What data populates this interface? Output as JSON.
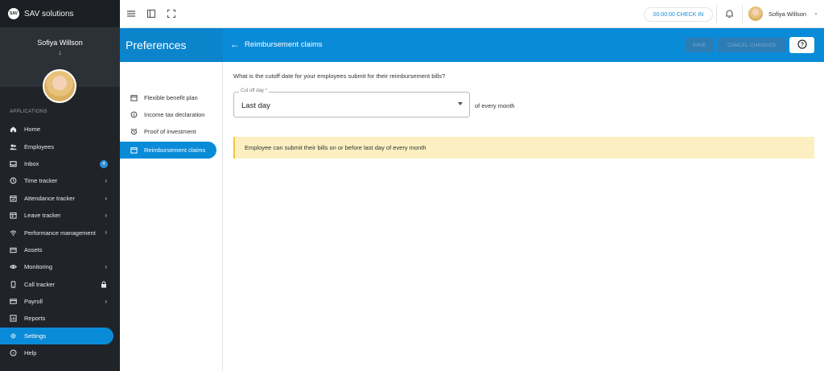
{
  "brand": {
    "logo_text": "SAV",
    "name": "SAV solutions"
  },
  "profile": {
    "name": "Sofiya Willson",
    "sub": "1"
  },
  "sidebar": {
    "section_label": "APPLICATIONS",
    "items": [
      {
        "label": "Home",
        "icon": "home-icon"
      },
      {
        "label": "Employees",
        "icon": "people-icon"
      },
      {
        "label": "Inbox",
        "icon": "inbox-icon",
        "badge": "4"
      },
      {
        "label": "Time tracker",
        "icon": "clock-icon",
        "has_chevron": true
      },
      {
        "label": "Attendance tracker",
        "icon": "calendar-check-icon",
        "has_chevron": true
      },
      {
        "label": "Leave tracker",
        "icon": "calendar-icon",
        "has_chevron": true
      },
      {
        "label": "Performance management",
        "icon": "signal-icon",
        "has_chevron": true
      },
      {
        "label": "Assets",
        "icon": "briefcase-icon"
      },
      {
        "label": "Monitoring",
        "icon": "eye-icon",
        "has_chevron": true
      },
      {
        "label": "Call tracker",
        "icon": "phone-icon",
        "locked": true
      },
      {
        "label": "Payroll",
        "icon": "card-icon",
        "has_chevron": true
      },
      {
        "label": "Reports",
        "icon": "report-icon"
      },
      {
        "label": "Settings",
        "icon": "gear-icon",
        "active": true
      },
      {
        "label": "Help",
        "icon": "help-icon"
      }
    ],
    "chevron": "›"
  },
  "topbar": {
    "checkin_label": "00:00:00 CHECK IN",
    "user_name": "Sofiya Willson",
    "user_menu_caret": "⌄"
  },
  "header": {
    "section_title": "Preferences",
    "back_arrow": "←",
    "page_title": "Reimbursement claims",
    "save_label": "SAVE",
    "cancel_label": "CANCEL CHANGES"
  },
  "submenu": {
    "items": [
      {
        "label": "Flexible benefit plan",
        "icon": "calendar-icon"
      },
      {
        "label": "Income tax declaration",
        "icon": "coin-icon"
      },
      {
        "label": "Proof of investment",
        "icon": "alarm-icon"
      },
      {
        "label": "Reimbursement claims",
        "icon": "calendar-icon",
        "active": true
      }
    ]
  },
  "form": {
    "question": "What is the cutoff date for your employees submit for their reimbursement bills?",
    "cutoff_label": "Cut off day *",
    "cutoff_value": "Last day",
    "suffix": "of every month",
    "notice": "Employee can submit their bills on or before last day of every month"
  },
  "colors": {
    "primary": "#0a8bd8",
    "sidebar_bg": "#202429",
    "notice_bg": "#fcf0c2"
  }
}
